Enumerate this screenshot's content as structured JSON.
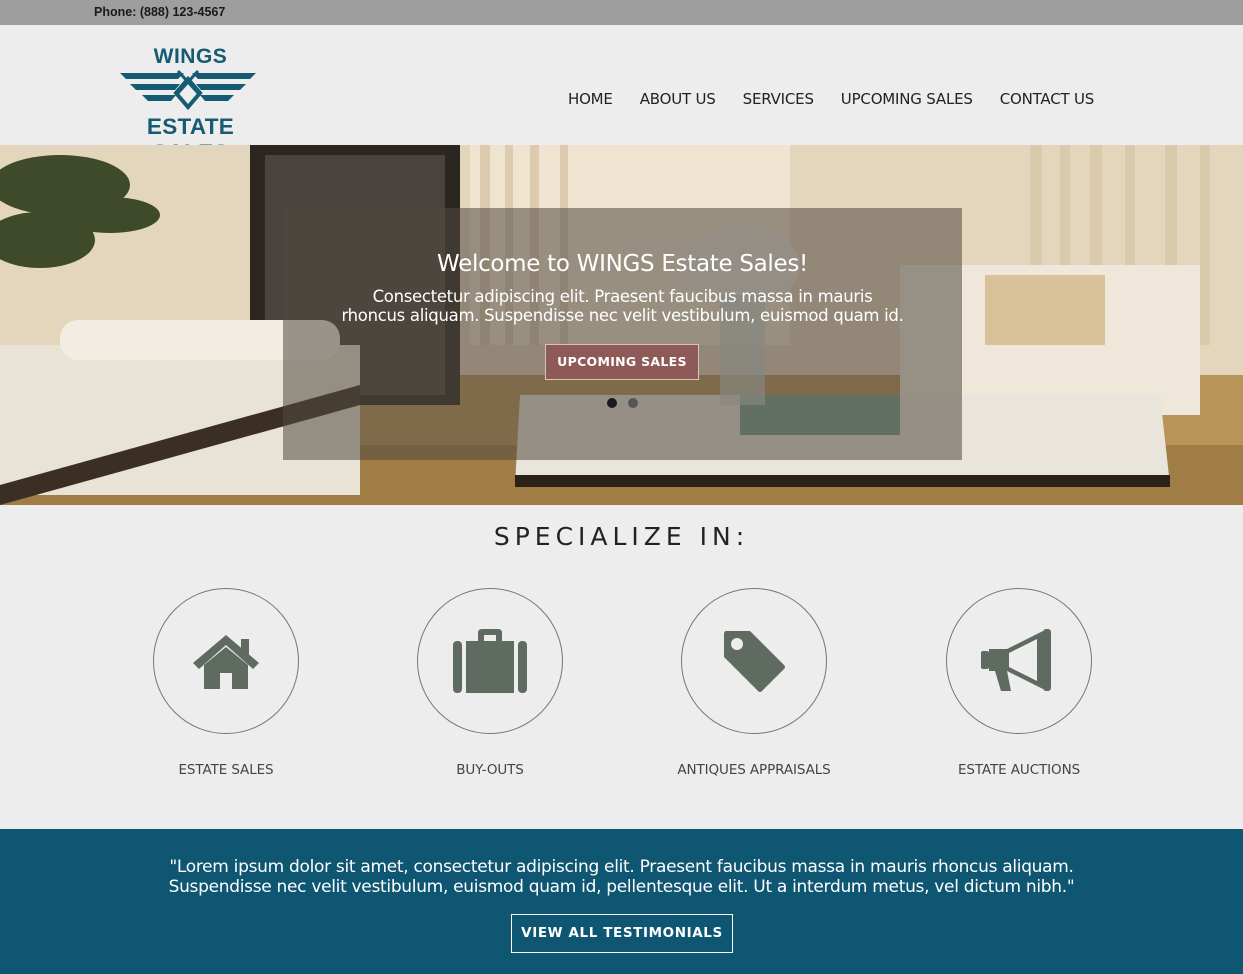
{
  "topbar": {
    "phone": "Phone: (888) 123-4567"
  },
  "brand": {
    "line1": "WINGS",
    "line2": "ESTATE SALES",
    "color": "#155b73"
  },
  "nav": {
    "items": [
      "HOME",
      "ABOUT US",
      "SERVICES",
      "UPCOMING SALES",
      "CONTACT US"
    ]
  },
  "hero": {
    "title": "Welcome to WINGS Estate Sales!",
    "subtitle_line1": "Consectetur adipiscing elit. Praesent faucibus massa in mauris",
    "subtitle_line2": "rhoncus aliquam. Suspendisse nec velit vestibulum, euismod quam id.",
    "button": "UPCOMING SALES",
    "slide_count": 2,
    "active_slide": 1,
    "button_color": "#8e5a58"
  },
  "specialize": {
    "title": "SPECIALIZE IN:",
    "services": [
      {
        "label": "ESTATE SALES",
        "icon": "house-icon"
      },
      {
        "label": "BUY-OUTS",
        "icon": "briefcase-icon"
      },
      {
        "label": "ANTIQUES APPRAISALS",
        "icon": "tag-icon"
      },
      {
        "label": "ESTATE AUCTIONS",
        "icon": "megaphone-icon"
      }
    ],
    "icon_color": "#5f6b60"
  },
  "testimonials": {
    "quote_line1": "\"Lorem ipsum dolor sit amet, consectetur adipiscing elit. Praesent faucibus massa in mauris rhoncus aliquam.",
    "quote_line2": "Suspendisse nec velit vestibulum, euismod quam id, pellentesque elit. Ut a interdum metus, vel dictum nibh.\"",
    "button": "VIEW ALL TESTIMONIALS",
    "background": "#0e5672"
  }
}
